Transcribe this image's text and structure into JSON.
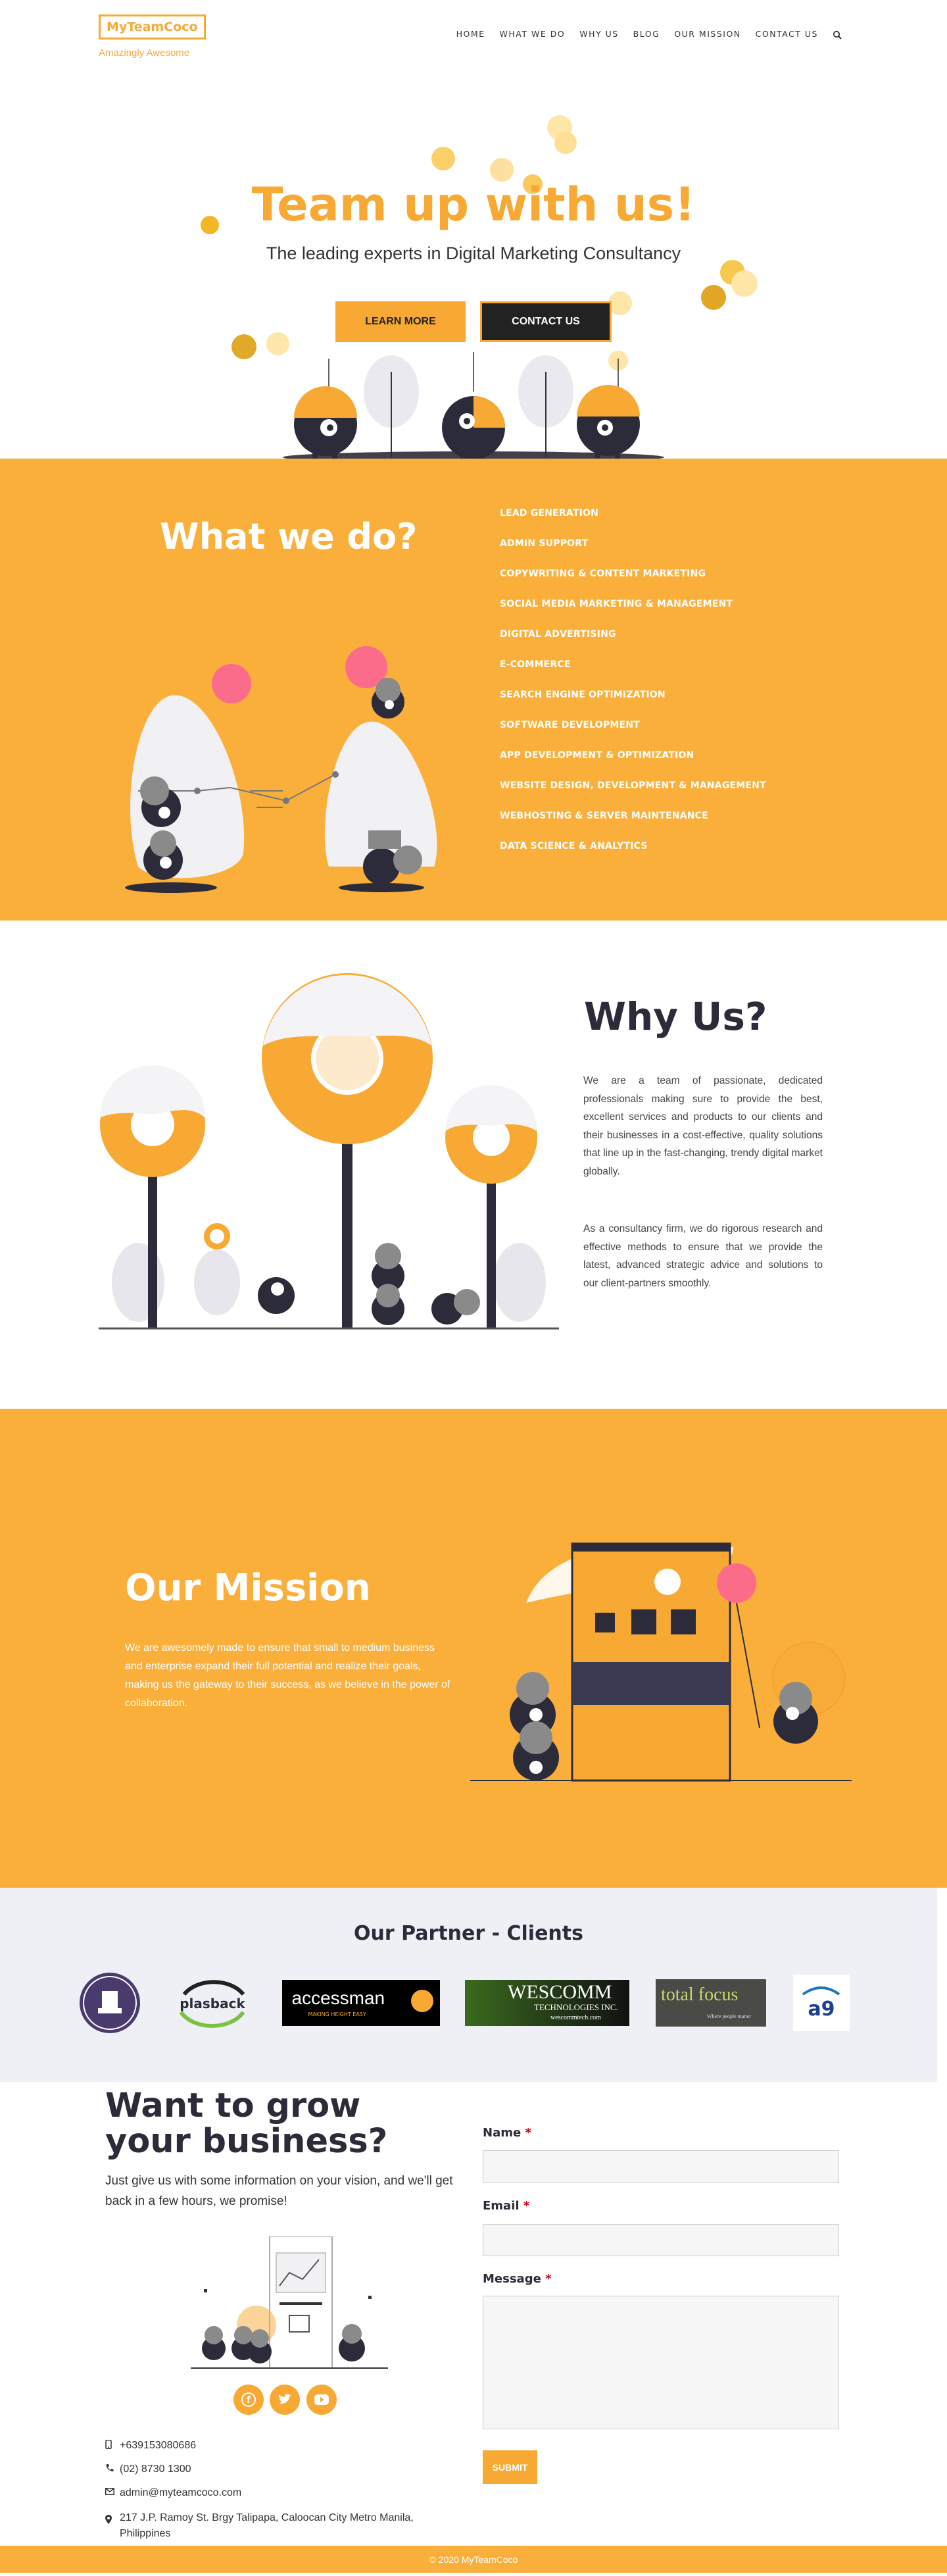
{
  "brand": {
    "logo": "MyTeamCoco",
    "tagline": "Amazingly Awesome",
    "accent": "#f7a934",
    "dark": "#2b2b3a"
  },
  "nav": {
    "items": [
      "HOME",
      "WHAT WE DO",
      "WHY US",
      "BLOG",
      "OUR MISSION",
      "CONTACT US"
    ],
    "search_icon": "search-icon"
  },
  "hero": {
    "title": "Team up with us!",
    "subtitle": "The leading experts in Digital Marketing Consultancy",
    "learn_more": "LEARN MORE",
    "contact_us": "CONTACT US"
  },
  "what_we_do": {
    "title": "What we do?",
    "services": [
      "LEAD GENERATION",
      "ADMIN SUPPORT",
      "COPYWRITING & CONTENT MARKETING",
      "SOCIAL MEDIA MARKETING & MANAGEMENT",
      "DIGITAL ADVERTISING",
      "E-COMMERCE",
      "SEARCH ENGINE OPTIMIZATION",
      "SOFTWARE DEVELOPMENT",
      "APP DEVELOPMENT & OPTIMIZATION",
      "WEBSITE DESIGN, DEVELOPMENT & MANAGEMENT",
      "WEBHOSTING & SERVER MAINTENANCE",
      "DATA SCIENCE & ANALYTICS"
    ]
  },
  "why_us": {
    "title": "Why Us?",
    "p1": "We are a team of passionate, dedicated professionals making sure to provide the best, excellent services and products to our clients and their businesses in a cost-effective, quality solutions that line up in the fast-changing, trendy digital market globally.",
    "p2": "As a consultancy firm, we do rigorous research and effective methods to ensure that we provide the latest, advanced strategic advice and solutions to our client-partners smoothly."
  },
  "mission": {
    "title": "Our Mission",
    "text": "We are awesomely made to ensure that small to medium business and enterprise expand their full potential and realize their goals, making us the gateway to their success, as we believe in the power of collaboration."
  },
  "partners": {
    "title": "Our Partner - Clients",
    "logos": [
      {
        "name": "seal-logo",
        "text": ""
      },
      {
        "name": "plasback-logo",
        "text": "plasback"
      },
      {
        "name": "accessman-logo",
        "text": "accessman",
        "sub": "MAKING HEIGHT EASY"
      },
      {
        "name": "wescomm-logo",
        "text": "WESCOMM",
        "sub": "TECHNOLOGIES INC.",
        "sub2": "wescommtech.com"
      },
      {
        "name": "totalfocus-logo",
        "text": "total focus",
        "sub": "Where people matter"
      },
      {
        "name": "a9-logo",
        "text": "a9"
      }
    ]
  },
  "contact": {
    "title": "Want to grow your business?",
    "text": "Just give us with some information on your vision, and we'll get back in a few hours, we promise!",
    "phone_mobile": "+639153080686",
    "phone_land": "(02) 8730 1300",
    "email": "admin@myteamcoco.com",
    "address": "217 J.P. Ramoy St. Brgy Talipapa, Caloocan City Metro Manila, Philippines",
    "form": {
      "name_label": "Name",
      "email_label": "Email",
      "message_label": "Message",
      "required": "*",
      "submit": "SUBMIT"
    },
    "social": [
      "facebook-icon",
      "twitter-icon",
      "youtube-icon"
    ]
  },
  "footer": {
    "text": "© 2020 MyTeamCoco"
  }
}
